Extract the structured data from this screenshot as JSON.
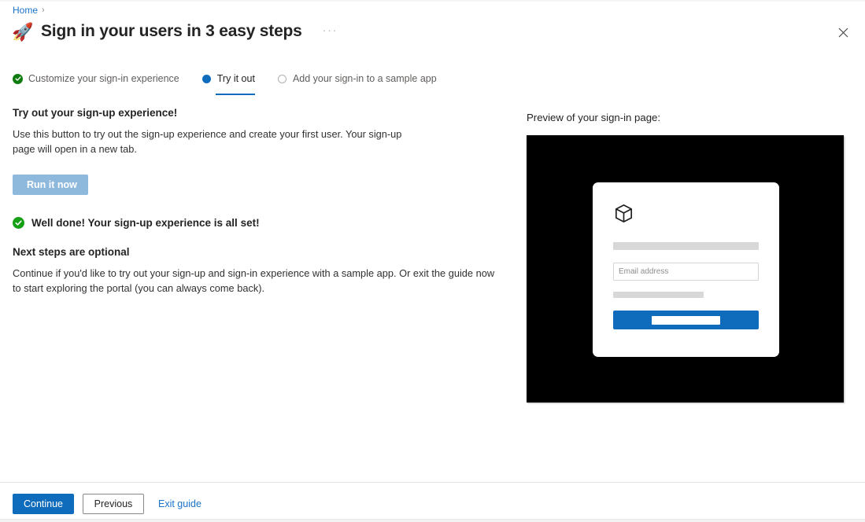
{
  "breadcrumb": {
    "home_label": "Home",
    "separator": "›"
  },
  "header": {
    "rocket_icon": "🚀",
    "title": "Sign in your users in 3 easy steps",
    "more_label": "···",
    "close_icon": "close-icon"
  },
  "steps": [
    {
      "label": "Customize your sign-in experience",
      "state": "done"
    },
    {
      "label": "Try it out",
      "state": "current"
    },
    {
      "label": "Add your sign-in to a sample app",
      "state": "todo"
    }
  ],
  "main": {
    "section_heading": "Try out your sign-up experience!",
    "section_body": "Use this button to try out the sign-up experience and create your first user. Your sign-up page will open in a new tab.",
    "run_button_label": "Run it now",
    "run_button_icon": "play-icon",
    "well_done_text": "Well done! Your sign-up experience is all set!",
    "next_steps_heading": "Next steps are optional",
    "next_steps_body": "Continue if you'd like to try out your sign-up and sign-in experience with a sample app. Or exit the guide now to start exploring the portal (you can always come back)."
  },
  "preview": {
    "label": "Preview of your sign-in page:",
    "logo_icon": "cube-icon",
    "email_placeholder": "Email address",
    "banner_text": "",
    "background_color": "#000000",
    "button_color": "#0f6cbd"
  },
  "footer": {
    "continue_label": "Continue",
    "previous_label": "Previous",
    "exit_label": "Exit guide"
  },
  "colors": {
    "accent": "#0f6cbd",
    "link": "#1a73c8",
    "success": "#107c10",
    "run_button": "#8fb8dd"
  }
}
